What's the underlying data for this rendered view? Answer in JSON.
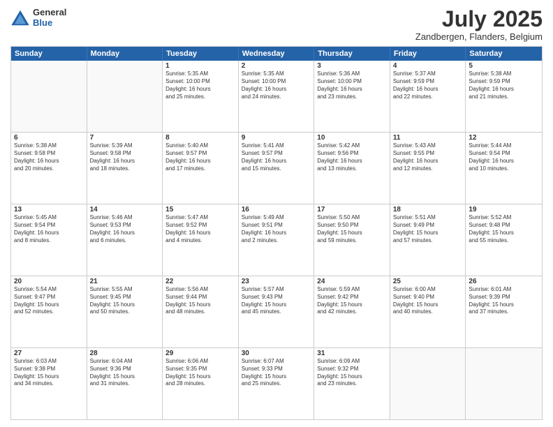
{
  "header": {
    "logo_line1": "General",
    "logo_line2": "Blue",
    "month": "July 2025",
    "location": "Zandbergen, Flanders, Belgium"
  },
  "weekdays": [
    "Sunday",
    "Monday",
    "Tuesday",
    "Wednesday",
    "Thursday",
    "Friday",
    "Saturday"
  ],
  "rows": [
    [
      {
        "day": "",
        "text": ""
      },
      {
        "day": "",
        "text": ""
      },
      {
        "day": "1",
        "text": "Sunrise: 5:35 AM\nSunset: 10:00 PM\nDaylight: 16 hours\nand 25 minutes."
      },
      {
        "day": "2",
        "text": "Sunrise: 5:35 AM\nSunset: 10:00 PM\nDaylight: 16 hours\nand 24 minutes."
      },
      {
        "day": "3",
        "text": "Sunrise: 5:36 AM\nSunset: 10:00 PM\nDaylight: 16 hours\nand 23 minutes."
      },
      {
        "day": "4",
        "text": "Sunrise: 5:37 AM\nSunset: 9:59 PM\nDaylight: 16 hours\nand 22 minutes."
      },
      {
        "day": "5",
        "text": "Sunrise: 5:38 AM\nSunset: 9:59 PM\nDaylight: 16 hours\nand 21 minutes."
      }
    ],
    [
      {
        "day": "6",
        "text": "Sunrise: 5:38 AM\nSunset: 9:58 PM\nDaylight: 16 hours\nand 20 minutes."
      },
      {
        "day": "7",
        "text": "Sunrise: 5:39 AM\nSunset: 9:58 PM\nDaylight: 16 hours\nand 18 minutes."
      },
      {
        "day": "8",
        "text": "Sunrise: 5:40 AM\nSunset: 9:57 PM\nDaylight: 16 hours\nand 17 minutes."
      },
      {
        "day": "9",
        "text": "Sunrise: 5:41 AM\nSunset: 9:57 PM\nDaylight: 16 hours\nand 15 minutes."
      },
      {
        "day": "10",
        "text": "Sunrise: 5:42 AM\nSunset: 9:56 PM\nDaylight: 16 hours\nand 13 minutes."
      },
      {
        "day": "11",
        "text": "Sunrise: 5:43 AM\nSunset: 9:55 PM\nDaylight: 16 hours\nand 12 minutes."
      },
      {
        "day": "12",
        "text": "Sunrise: 5:44 AM\nSunset: 9:54 PM\nDaylight: 16 hours\nand 10 minutes."
      }
    ],
    [
      {
        "day": "13",
        "text": "Sunrise: 5:45 AM\nSunset: 9:54 PM\nDaylight: 16 hours\nand 8 minutes."
      },
      {
        "day": "14",
        "text": "Sunrise: 5:46 AM\nSunset: 9:53 PM\nDaylight: 16 hours\nand 6 minutes."
      },
      {
        "day": "15",
        "text": "Sunrise: 5:47 AM\nSunset: 9:52 PM\nDaylight: 16 hours\nand 4 minutes."
      },
      {
        "day": "16",
        "text": "Sunrise: 5:49 AM\nSunset: 9:51 PM\nDaylight: 16 hours\nand 2 minutes."
      },
      {
        "day": "17",
        "text": "Sunrise: 5:50 AM\nSunset: 9:50 PM\nDaylight: 15 hours\nand 59 minutes."
      },
      {
        "day": "18",
        "text": "Sunrise: 5:51 AM\nSunset: 9:49 PM\nDaylight: 15 hours\nand 57 minutes."
      },
      {
        "day": "19",
        "text": "Sunrise: 5:52 AM\nSunset: 9:48 PM\nDaylight: 15 hours\nand 55 minutes."
      }
    ],
    [
      {
        "day": "20",
        "text": "Sunrise: 5:54 AM\nSunset: 9:47 PM\nDaylight: 15 hours\nand 52 minutes."
      },
      {
        "day": "21",
        "text": "Sunrise: 5:55 AM\nSunset: 9:45 PM\nDaylight: 15 hours\nand 50 minutes."
      },
      {
        "day": "22",
        "text": "Sunrise: 5:56 AM\nSunset: 9:44 PM\nDaylight: 15 hours\nand 48 minutes."
      },
      {
        "day": "23",
        "text": "Sunrise: 5:57 AM\nSunset: 9:43 PM\nDaylight: 15 hours\nand 45 minutes."
      },
      {
        "day": "24",
        "text": "Sunrise: 5:59 AM\nSunset: 9:42 PM\nDaylight: 15 hours\nand 42 minutes."
      },
      {
        "day": "25",
        "text": "Sunrise: 6:00 AM\nSunset: 9:40 PM\nDaylight: 15 hours\nand 40 minutes."
      },
      {
        "day": "26",
        "text": "Sunrise: 6:01 AM\nSunset: 9:39 PM\nDaylight: 15 hours\nand 37 minutes."
      }
    ],
    [
      {
        "day": "27",
        "text": "Sunrise: 6:03 AM\nSunset: 9:38 PM\nDaylight: 15 hours\nand 34 minutes."
      },
      {
        "day": "28",
        "text": "Sunrise: 6:04 AM\nSunset: 9:36 PM\nDaylight: 15 hours\nand 31 minutes."
      },
      {
        "day": "29",
        "text": "Sunrise: 6:06 AM\nSunset: 9:35 PM\nDaylight: 15 hours\nand 28 minutes."
      },
      {
        "day": "30",
        "text": "Sunrise: 6:07 AM\nSunset: 9:33 PM\nDaylight: 15 hours\nand 25 minutes."
      },
      {
        "day": "31",
        "text": "Sunrise: 6:09 AM\nSunset: 9:32 PM\nDaylight: 15 hours\nand 23 minutes."
      },
      {
        "day": "",
        "text": ""
      },
      {
        "day": "",
        "text": ""
      }
    ]
  ]
}
